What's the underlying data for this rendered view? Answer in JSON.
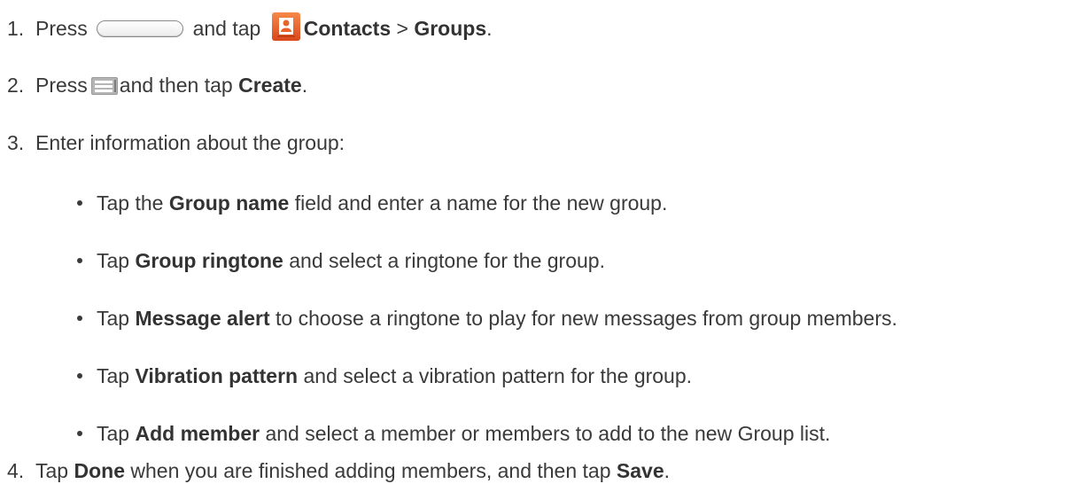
{
  "steps": [
    {
      "num": "1.",
      "t1": "Press",
      "t2": "and tap",
      "b1": "Contacts",
      "t3": ">",
      "b2": "Groups",
      "t4": "."
    },
    {
      "num": "2.",
      "t1": "Press",
      "t2": "and then tap",
      "b1": "Create",
      "t3": "."
    },
    {
      "num": "3.",
      "t1": "Enter information about the group:"
    },
    {
      "num": "4.",
      "t1": "Tap",
      "b1": "Done",
      "t2": "when you are finished adding members, and then tap",
      "b2": "Save",
      "t3": "."
    }
  ],
  "bullets": [
    {
      "pre": "Tap the",
      "bold": "Group name",
      "post": "field and enter a name for the new group."
    },
    {
      "pre": "Tap",
      "bold": "Group ringtone",
      "post": "and select a ringtone for the group."
    },
    {
      "pre": "Tap",
      "bold": "Message alert",
      "post": "to choose a ringtone to play for new messages from group members."
    },
    {
      "pre": "Tap",
      "bold": "Vibration pattern",
      "post": "and select a vibration pattern for the group."
    },
    {
      "pre": "Tap",
      "bold": "Add member",
      "post": "and select a member or members to add to the new Group list."
    }
  ],
  "icons": {
    "contacts_color": "#e8632a",
    "home_button": "home-button-icon",
    "contacts": "contacts-app-icon",
    "menu": "menu-key-icon"
  }
}
